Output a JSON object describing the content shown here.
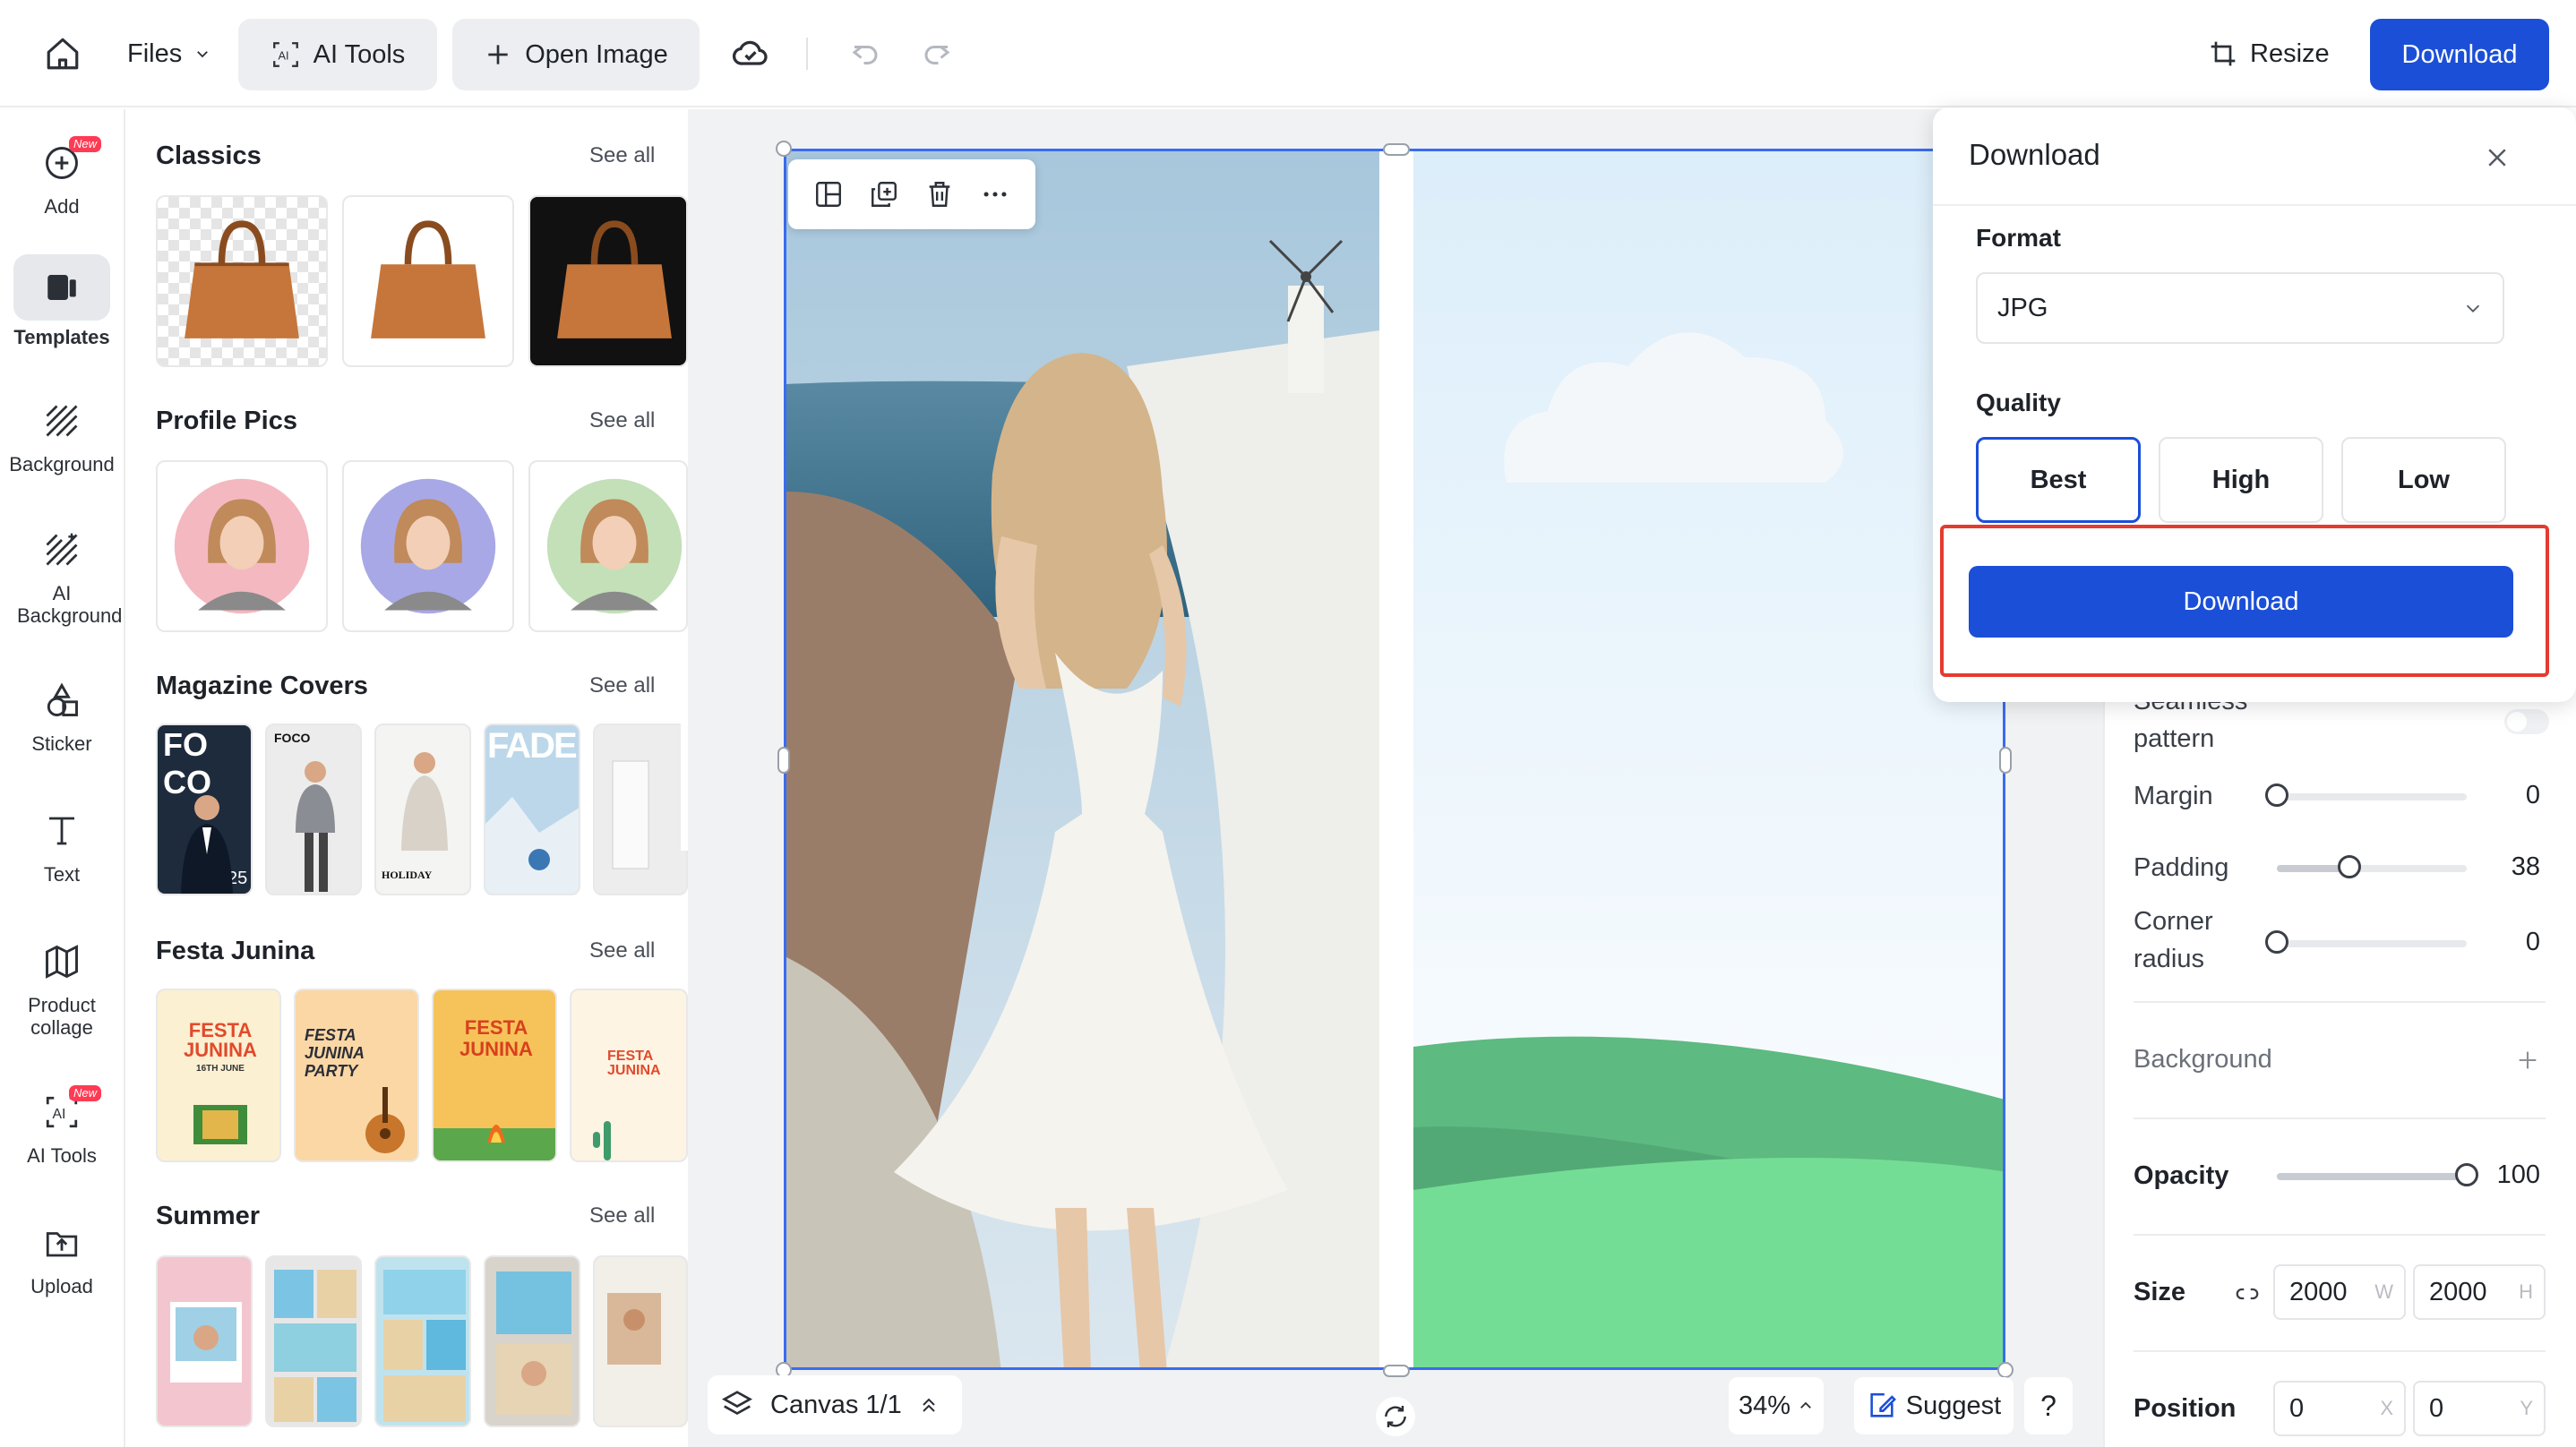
{
  "topbar": {
    "files_label": "Files",
    "ai_tools_label": "AI Tools",
    "open_image_label": "Open Image",
    "resize_label": "Resize",
    "download_label": "Download"
  },
  "rail": {
    "items": [
      {
        "label": "Add",
        "badge": "New"
      },
      {
        "label": "Templates"
      },
      {
        "label": "Background"
      },
      {
        "label": "AI Background"
      },
      {
        "label": "Sticker"
      },
      {
        "label": "Text"
      },
      {
        "label": "Product collage"
      },
      {
        "label": "AI Tools",
        "badge": "New"
      },
      {
        "label": "Upload"
      }
    ]
  },
  "panel": {
    "see_all": "See all",
    "sections": [
      {
        "title": "Classics"
      },
      {
        "title": "Profile Pics"
      },
      {
        "title": "Magazine Covers"
      },
      {
        "title": "Festa Junina"
      },
      {
        "title": "Summer"
      }
    ],
    "magazine": {
      "t1a": "FO",
      "t1b": "CO",
      "t1num": "25",
      "t2": "FOCO",
      "t3": "HOLIDAY",
      "t4": "FADE"
    },
    "festa": {
      "t1": "FESTA JUNINA",
      "t1sub": "16TH JUNE",
      "t2": "FESTA JUNINA PARTY",
      "t3": "FESTA JUNINA",
      "t4": "FESTA JUNINA"
    }
  },
  "canvas": {
    "canvas_label": "Canvas 1/1",
    "zoom": "34%",
    "suggest_label": "Suggest",
    "help_label": "?"
  },
  "props": {
    "seamless_label": "Seamless pattern",
    "margin_label": "Margin",
    "margin_value": "0",
    "margin_level": 0,
    "padding_label": "Padding",
    "padding_value": "38",
    "padding_level": 0.38,
    "corner_label": "Corner radius",
    "corner_value": "0",
    "corner_level": 0,
    "background_label": "Background",
    "opacity_label": "Opacity",
    "opacity_value": "100",
    "opacity_level": 1,
    "size_label": "Size",
    "size_w": "2000",
    "size_h": "2000",
    "w_unit": "W",
    "h_unit": "H",
    "position_label": "Position",
    "pos_x": "0",
    "pos_y": "0",
    "x_unit": "X",
    "y_unit": "Y"
  },
  "download_popup": {
    "title": "Download",
    "format_label": "Format",
    "format_value": "JPG",
    "quality_label": "Quality",
    "quality_options": [
      "Best",
      "High",
      "Low"
    ],
    "selected_quality": "Best",
    "download_button": "Download"
  },
  "colors": {
    "accent": "#1b4fd8",
    "highlight": "#e43b2f",
    "selection": "#3a6cf0"
  }
}
